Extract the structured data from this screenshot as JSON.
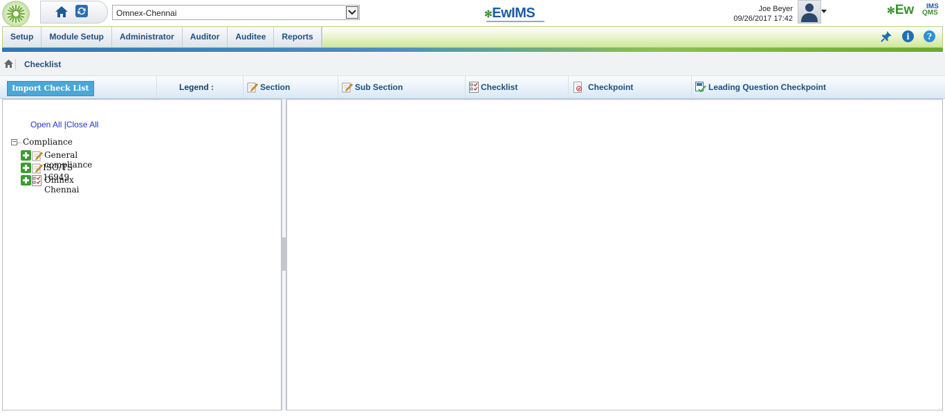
{
  "header": {
    "site_selector": {
      "value": "Omnex-Chennai"
    },
    "product_logo": "EwIMS",
    "user": {
      "name": "Joe Beyer",
      "datetime": "09/26/2017 17:42"
    },
    "right_logo": {
      "main": "Ew",
      "top": "IMS",
      "bottom": "QMS"
    }
  },
  "nav": {
    "tabs": [
      "Setup",
      "Module Setup",
      "Administrator",
      "Auditor",
      "Auditee",
      "Reports"
    ]
  },
  "breadcrumb": {
    "title": "Checklist"
  },
  "legend": {
    "import_button": "Import Check List",
    "label": "Legend :",
    "items": [
      "Section",
      "Sub Section",
      "Checklist",
      "Checkpoint",
      "Leading Question Checkpoint"
    ]
  },
  "tree": {
    "open_all": "Open All",
    "separator": "|",
    "close_all": "Close All",
    "root": "Compliance",
    "nodes": [
      "General compliance",
      "ISO/TS 16949",
      "Omnex Chennai"
    ]
  },
  "colors": {
    "accent": "#1f4f7d",
    "button": "#4aa7d6",
    "green": "#3d9a34"
  }
}
